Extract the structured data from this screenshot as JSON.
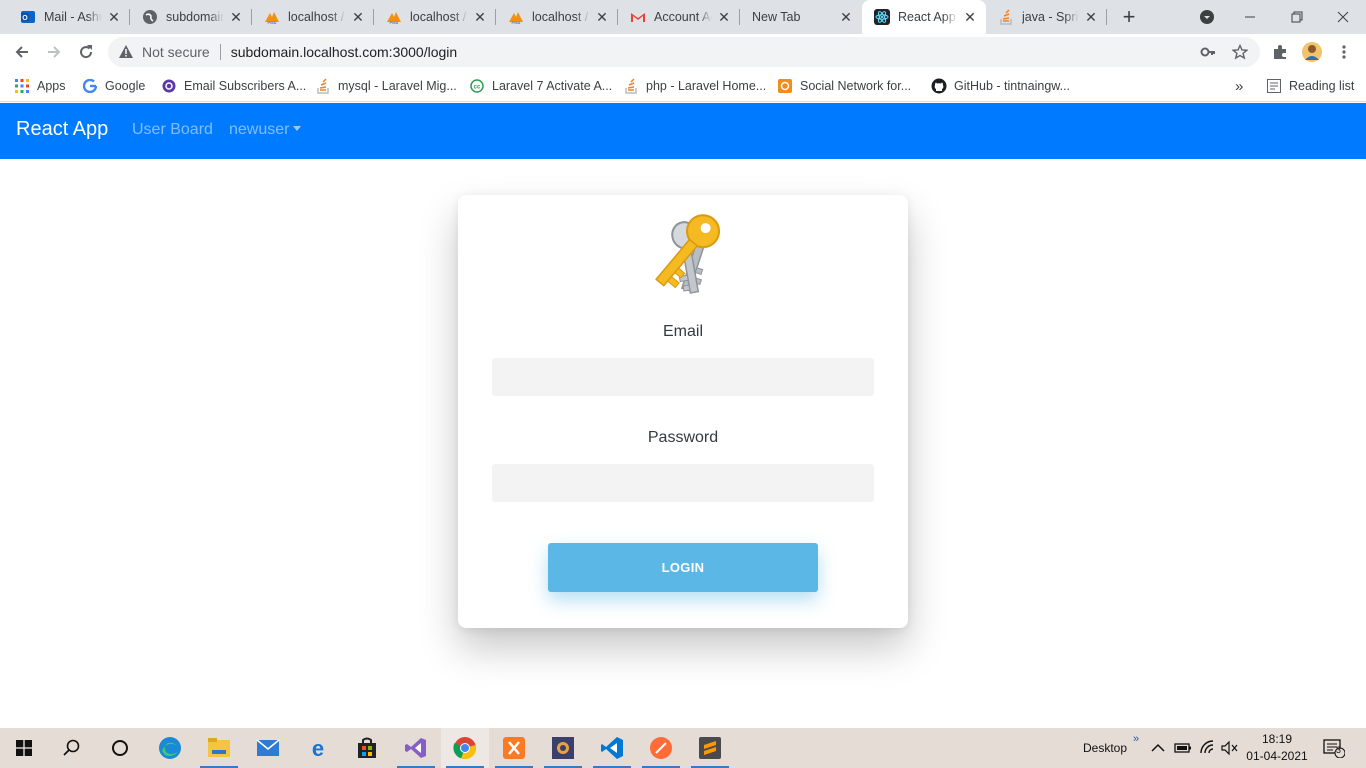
{
  "browser": {
    "tabs": [
      {
        "title": "Mail - Ashu",
        "icon": "outlook-icon",
        "active": false
      },
      {
        "title": "subdomain",
        "icon": "globe-icon",
        "active": false
      },
      {
        "title": "localhost /",
        "icon": "phpmyadmin-icon",
        "active": false
      },
      {
        "title": "localhost /",
        "icon": "phpmyadmin-icon",
        "active": false
      },
      {
        "title": "localhost /",
        "icon": "phpmyadmin-icon",
        "active": false
      },
      {
        "title": "Account Ac",
        "icon": "gmail-icon",
        "active": false
      },
      {
        "title": "New Tab",
        "icon": "",
        "active": false
      },
      {
        "title": "React App",
        "icon": "react-icon",
        "active": true
      },
      {
        "title": "java - Sprin",
        "icon": "stackoverflow-icon",
        "active": false
      }
    ],
    "security_label": "Not secure",
    "url": "subdomain.localhost.com:3000/login",
    "bookmarks": [
      {
        "label": "Apps",
        "icon": "apps-grid-icon"
      },
      {
        "label": "Google",
        "icon": "google-icon"
      },
      {
        "label": "Email Subscribers A...",
        "icon": "email-subscribers-icon"
      },
      {
        "label": "mysql - Laravel Mig...",
        "icon": "stackoverflow-icon"
      },
      {
        "label": "Laravel 7 Activate A...",
        "icon": "cc-icon"
      },
      {
        "label": "php - Laravel Home...",
        "icon": "stackoverflow-icon"
      },
      {
        "label": "Social Network for...",
        "icon": "social-network-icon"
      },
      {
        "label": "GitHub - tintnaingw...",
        "icon": "github-icon"
      }
    ],
    "more_bookmarks": "»",
    "reading_list": "Reading list"
  },
  "app": {
    "brand": "React App",
    "nav_user_board": "User Board",
    "nav_user": "newuser",
    "accent_color": "#007bff"
  },
  "login": {
    "email_label": "Email",
    "email_value": "",
    "password_label": "Password",
    "password_value": "",
    "button_label": "LOGIN",
    "button_color": "#5bb7e6"
  },
  "taskbar": {
    "desktop_label": "Desktop",
    "chevron": "»",
    "time": "18:19",
    "date": "01-04-2021",
    "notifications": "3"
  }
}
